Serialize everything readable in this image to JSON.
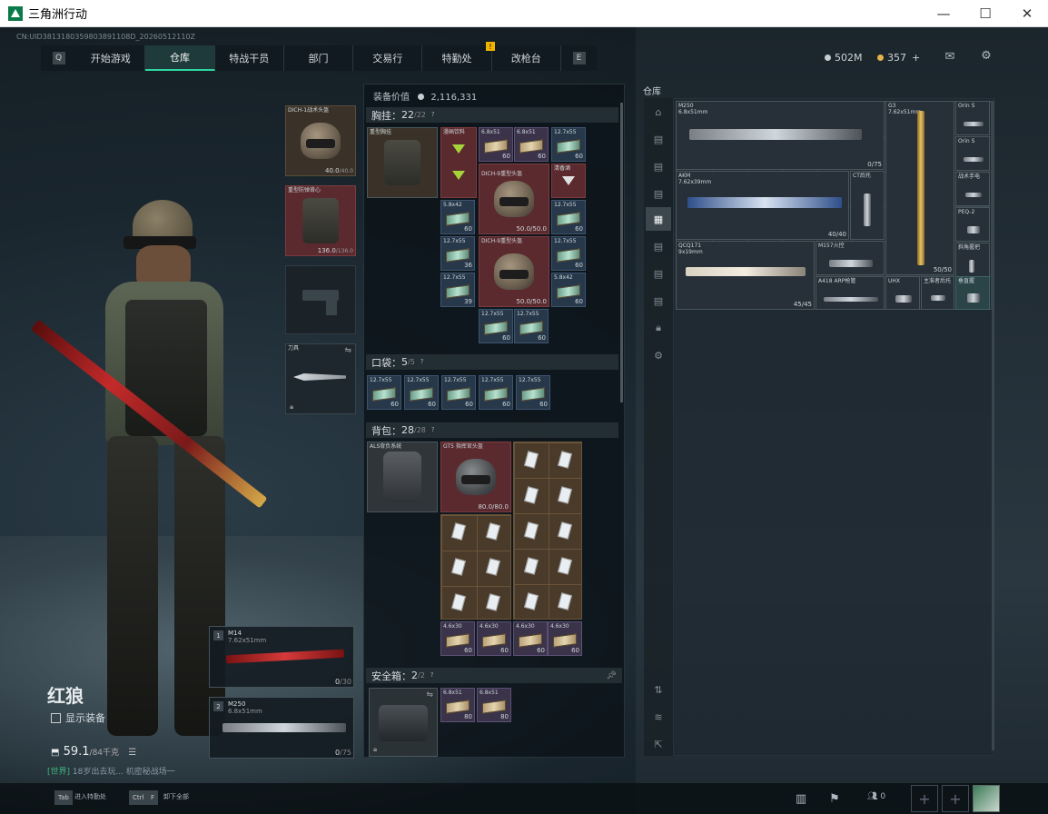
{
  "window": {
    "title": "三角洲行动",
    "min": "—",
    "max": "☐",
    "close": "✕"
  },
  "session_id": "CN:UID3813180359803891108D_20260512110Z",
  "nav": {
    "left_key": "Q",
    "right_key": "E",
    "tabs": [
      "开始游戏",
      "仓库",
      "特战干员",
      "部门",
      "交易行",
      "特勤处",
      "改枪台"
    ],
    "active": "仓库",
    "badge": "!"
  },
  "currency": {
    "silver": "502M",
    "gold": "357",
    "plus": "+"
  },
  "colors": {
    "accent": "#2ed6a0",
    "gold_badge": "#f0b400"
  },
  "equipment": {
    "helmet": {
      "name": "DICH-1战术头盔",
      "durability": "40.0",
      "max": "/40.0"
    },
    "armor": {
      "name": "重型防弹背心",
      "durability": "136.0",
      "max": "/136.0"
    },
    "melee": {
      "label": "刀具"
    }
  },
  "loadout": {
    "value_label": "装备价值",
    "value": "2,116,331",
    "chest": {
      "label": "胸挂：",
      "count": "22",
      "max": "/22"
    },
    "pocket": {
      "label": "口袋：",
      "count": "5",
      "max": "/5"
    },
    "backpack": {
      "label": "背包：",
      "count": "28",
      "max": "/28"
    },
    "safe": {
      "label": "安全箱：",
      "count": "2",
      "max": "/2"
    }
  },
  "chest_items": [
    {
      "name": "重型胸挂",
      "type": "vest"
    },
    {
      "name": "漫画饮料",
      "type": "drink"
    },
    {
      "name": "6.8x51",
      "count": "60"
    },
    {
      "name": "6.8x51",
      "count": "60"
    },
    {
      "name": "12.7x55",
      "count": "60"
    },
    {
      "name": "DICH-9重型头盔",
      "durability": "50.0/50.0"
    },
    {
      "name": "清香酒",
      "type": "drink"
    },
    {
      "name": "5.8x42",
      "count": "60"
    },
    {
      "name": "12.7x55",
      "count": "60"
    },
    {
      "name": "12.7x55",
      "count": "36"
    },
    {
      "name": "DICH-9重型头盔",
      "durability": "50.0/50.0"
    },
    {
      "name": "12.7x55",
      "count": "60"
    },
    {
      "name": "12.7x55",
      "count": "39"
    },
    {
      "name": "5.8x42",
      "count": "60"
    },
    {
      "name": "12.7x55",
      "count": "60"
    },
    {
      "name": "12.7x55",
      "count": "60"
    }
  ],
  "pocket_items": [
    {
      "name": "12.7x55",
      "count": "60"
    },
    {
      "name": "12.7x55",
      "count": "60"
    },
    {
      "name": "12.7x55",
      "count": "60"
    },
    {
      "name": "12.7x55",
      "count": "60"
    },
    {
      "name": "12.7x55",
      "count": "60"
    }
  ],
  "backpack_items": {
    "pack": "ALS背负系统",
    "helmet": {
      "name": "GT5 指挥官头盔",
      "durability": "80.0/80.0"
    },
    "ammo": [
      {
        "name": "4.6x30",
        "count": "60"
      },
      {
        "name": "4.6x30",
        "count": "60"
      },
      {
        "name": "4.6x30",
        "count": "60"
      },
      {
        "name": "4.6x30",
        "count": "60"
      }
    ]
  },
  "safe_items": [
    {
      "name": "6.8x51",
      "count": "80"
    },
    {
      "name": "6.8x51",
      "count": "80"
    }
  ],
  "character": {
    "name": "红狼",
    "show_gear": "显示装备",
    "level": "59.1",
    "level_sub": "/84千克"
  },
  "chat": {
    "channel": "[世界]",
    "text": "18岁出去玩... 机密秘战场一"
  },
  "weapons": [
    {
      "slot": "1",
      "name": "M14",
      "caliber": "7.62x51mm",
      "ammo": "0",
      "max": "/30"
    },
    {
      "slot": "2",
      "name": "M250",
      "caliber": "6.8x51mm",
      "ammo": "0",
      "max": "/75"
    }
  ],
  "stash": {
    "title": "仓库",
    "items": [
      {
        "name": "M250",
        "sub": "6.8x51mm",
        "ammo": "0/75"
      },
      {
        "name": "G3",
        "sub": "7.62x51mm",
        "ammo": "50/50"
      },
      {
        "name": "Orin S"
      },
      {
        "name": "Orin S"
      },
      {
        "name": "AKM",
        "sub": "7.62x39mm",
        "ammo": "40/40"
      },
      {
        "name": "CT后托"
      },
      {
        "name": "战术手电"
      },
      {
        "name": "PEQ-2"
      },
      {
        "name": "QCQ171",
        "sub": "9x19mm",
        "ammo": "45/45"
      },
      {
        "name": "M157火控"
      },
      {
        "name": "斜角握把"
      },
      {
        "name": "A418",
        "sub": "ARP枪管"
      },
      {
        "name": "UHX"
      },
      {
        "name": "主准者后托"
      },
      {
        "name": "垂直握"
      }
    ]
  },
  "bottom": {
    "tab_key": "Tab",
    "tab_label": "进入特勤处",
    "ctrl_key": "Ctrl",
    "f_key": "F",
    "ctrl_label": "卸下全部",
    "friends": "0"
  }
}
